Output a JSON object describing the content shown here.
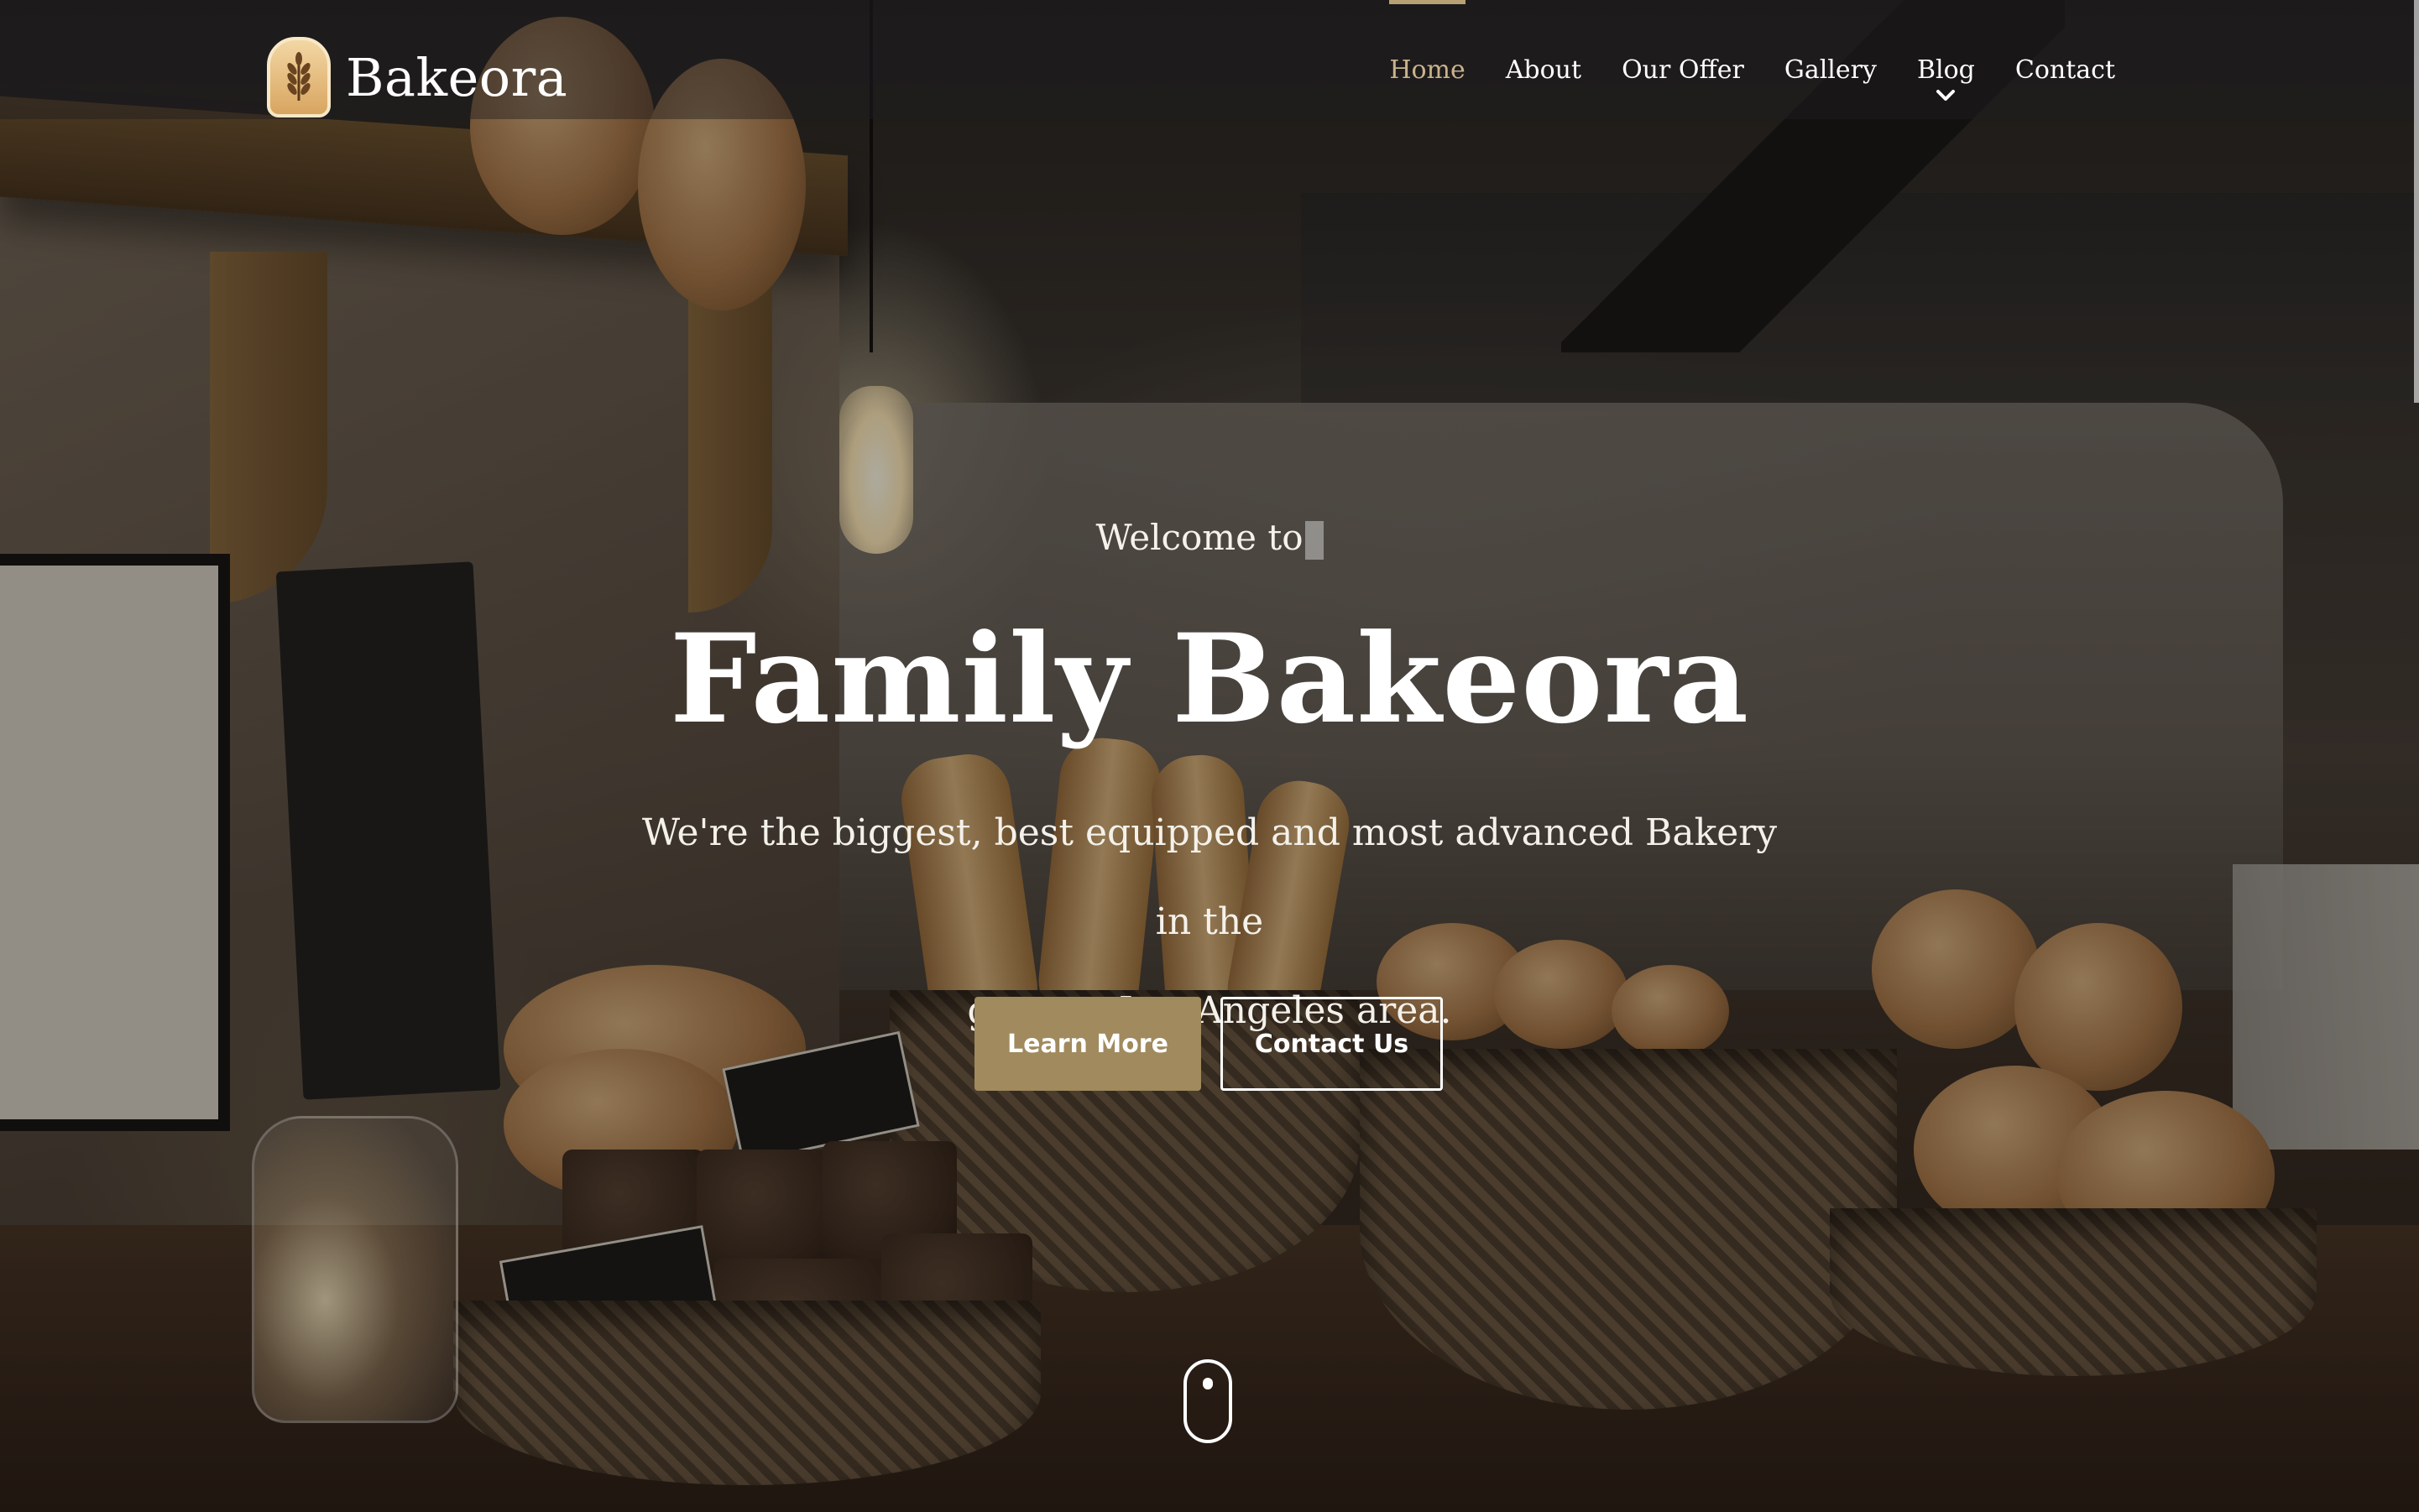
{
  "brand": {
    "name": "Bakeora",
    "logo_icon": "wheat-logo-icon"
  },
  "nav": {
    "items": [
      {
        "label": "Home",
        "active": true
      },
      {
        "label": "About",
        "active": false
      },
      {
        "label": "Our Offer",
        "active": false
      },
      {
        "label": "Gallery",
        "active": false
      },
      {
        "label": "Blog",
        "active": false,
        "has_dropdown": true
      },
      {
        "label": "Contact",
        "active": false
      }
    ],
    "active_color": "#c9b38c"
  },
  "hero": {
    "welcome": "Welcome to",
    "title": "Family Bakeora",
    "subtitle_line1": "We're the biggest, best equipped and most advanced Bakery in the",
    "subtitle_line2": "greater Los Angeles area.",
    "primary_button": "Learn More",
    "secondary_button": "Contact Us",
    "scroll_icon": "mouse-scroll-icon"
  },
  "colors": {
    "accent": "#a08a5e",
    "text": "#ffffff"
  }
}
